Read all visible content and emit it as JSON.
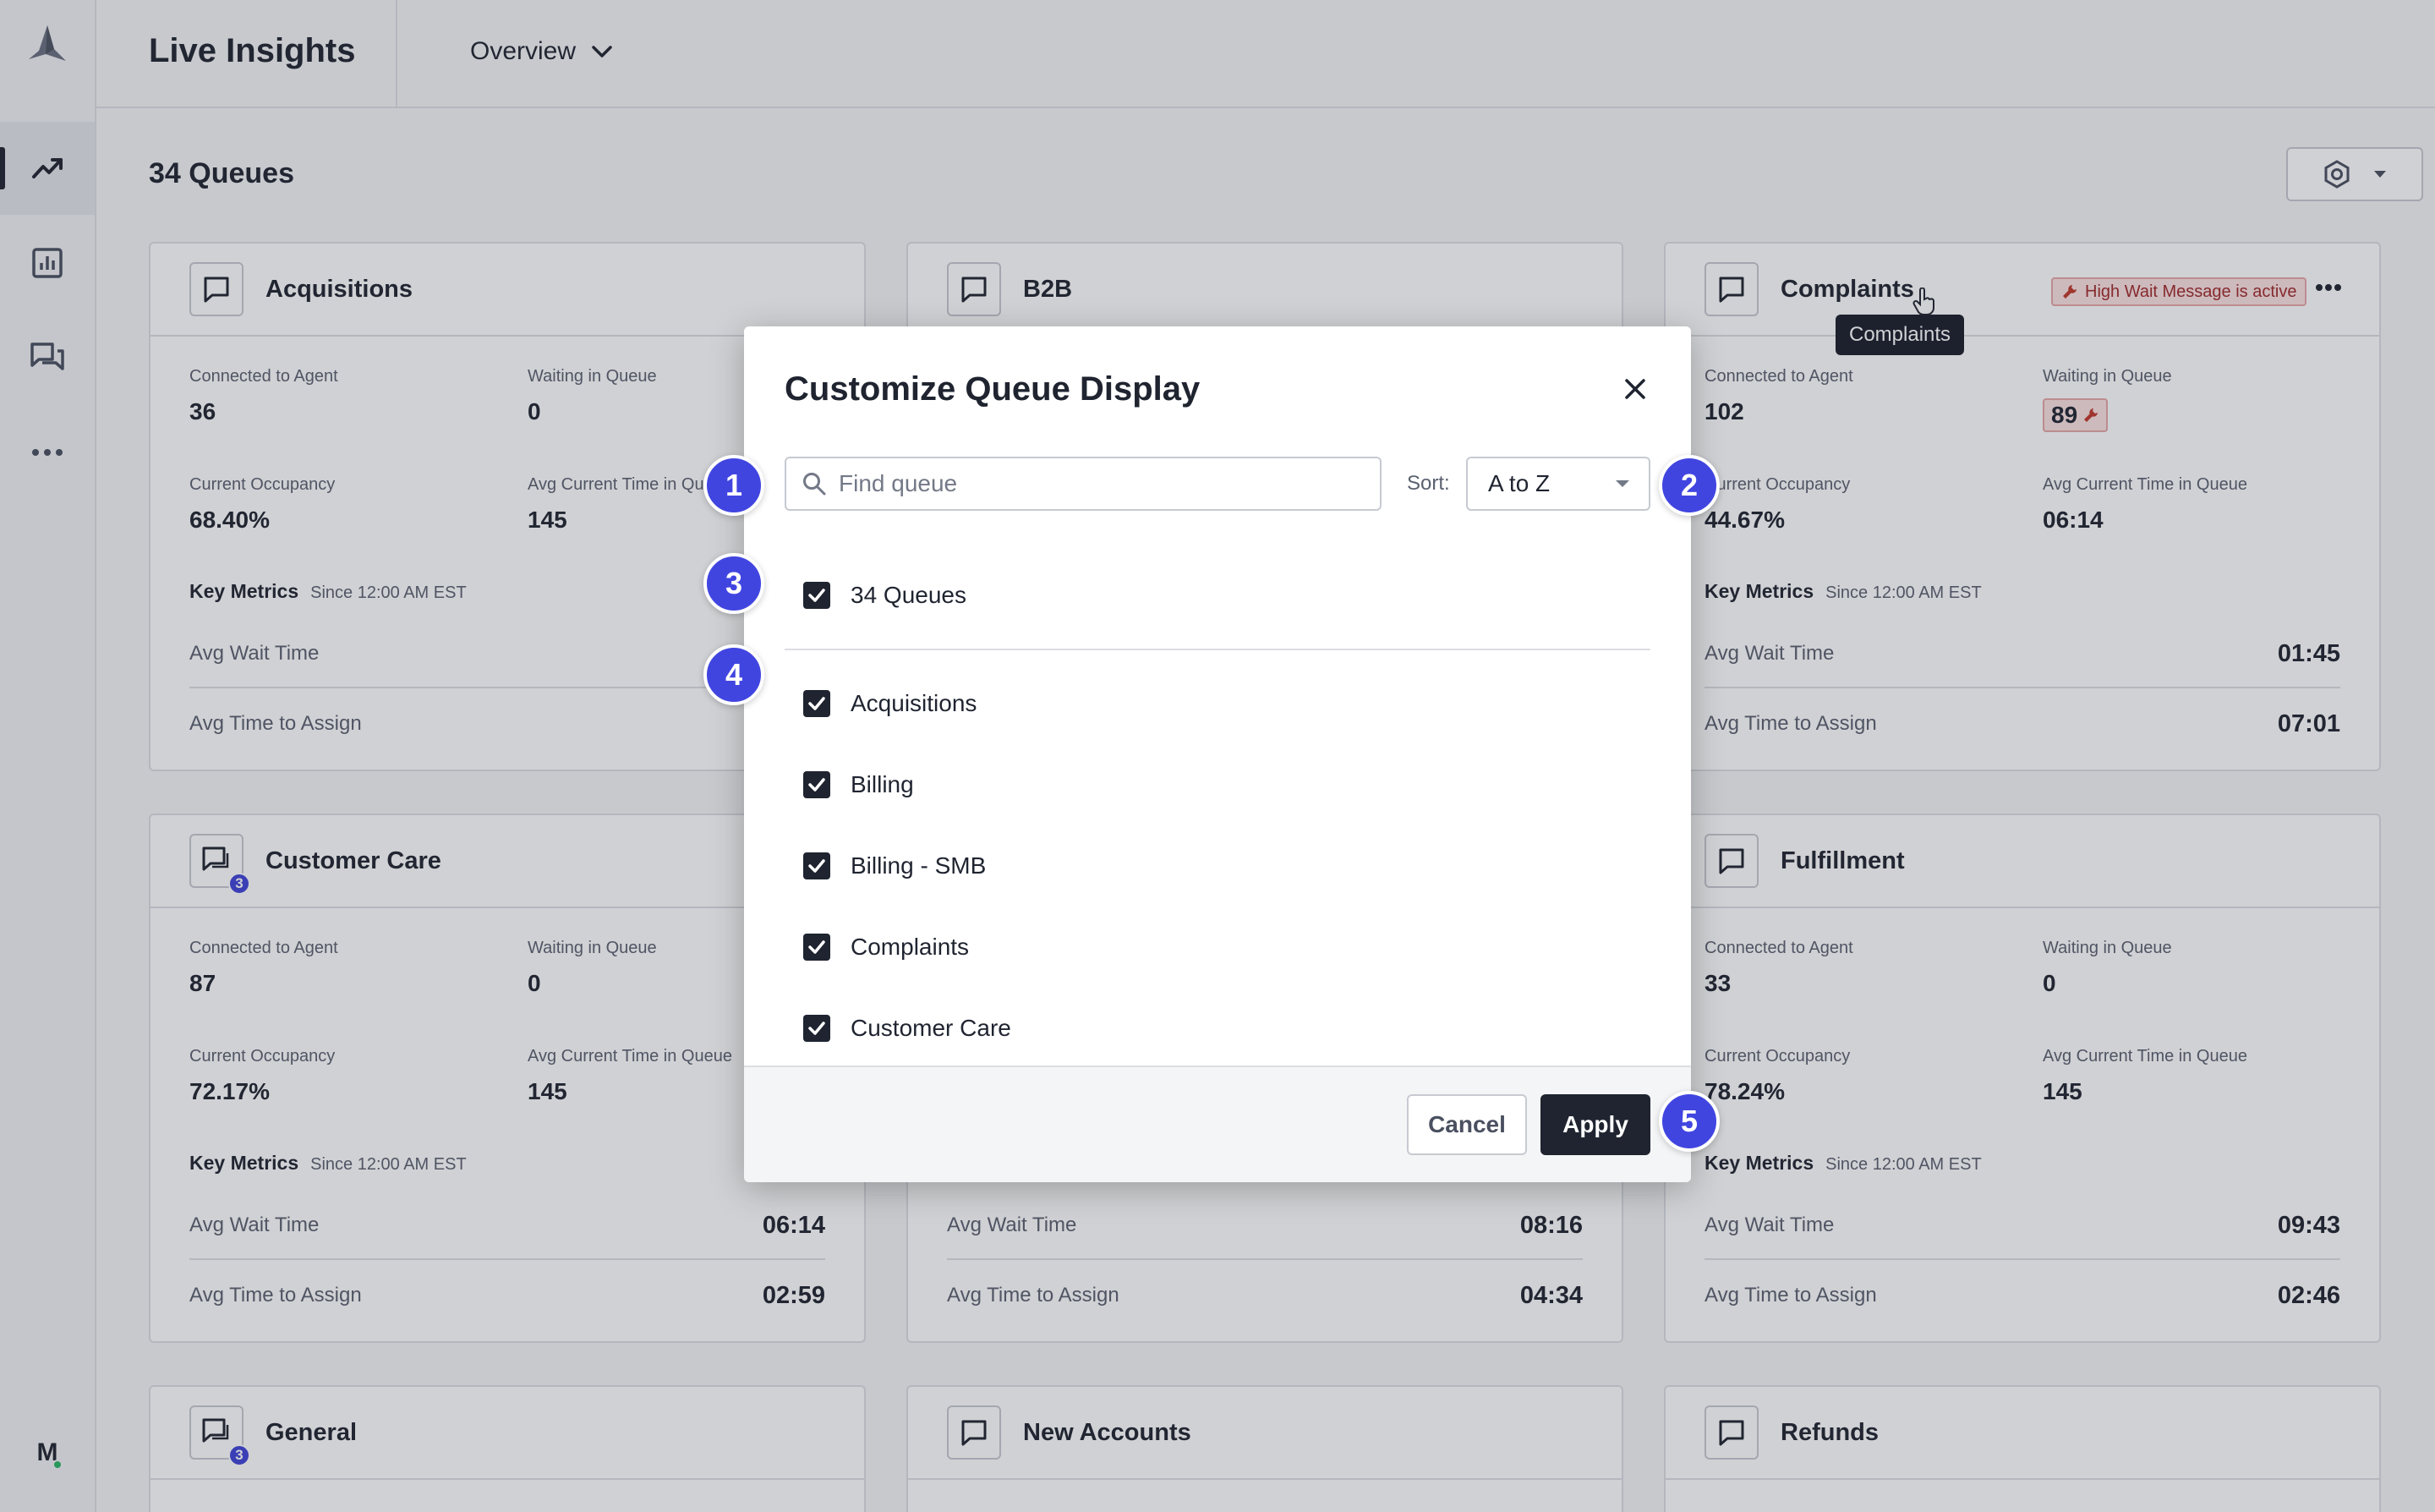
{
  "app": {
    "title": "Live Insights",
    "view": "Overview",
    "avatar_initial": "M"
  },
  "sidebar": {
    "items": [
      {
        "icon": "trending-up-icon"
      },
      {
        "icon": "bar-chart-icon"
      },
      {
        "icon": "chat-bubbles-icon"
      },
      {
        "icon": "more-horizontal-icon"
      }
    ]
  },
  "page": {
    "title": "34 Queues"
  },
  "labels": {
    "connected": "Connected to Agent",
    "waiting": "Waiting in Queue",
    "occupancy": "Current Occupancy",
    "avg_current": "Avg Current Time in Queue",
    "key_metrics": "Key Metrics",
    "since": "Since 12:00 AM EST",
    "avg_wait": "Avg Wait Time",
    "avg_assign": "Avg Time to Assign"
  },
  "cards": [
    {
      "name": "Acquisitions",
      "connected": "36",
      "waiting": "0",
      "occupancy": "68.40%",
      "avg_current": "145",
      "avg_wait": "",
      "avg_assign": ""
    },
    {
      "name": "B2B"
    },
    {
      "name": "Complaints",
      "connected": "102",
      "waiting": "89",
      "occupancy": "44.67%",
      "avg_current": "06:14",
      "avg_wait": "01:45",
      "avg_assign": "07:01",
      "badge": "High Wait Message is active",
      "tooltip": "Complaints"
    },
    {
      "name": "Customer Care",
      "badge_count": "3",
      "connected": "87",
      "waiting": "0",
      "occupancy": "72.17%",
      "avg_current": "145",
      "avg_wait": "06:14",
      "avg_assign": "02:59"
    },
    {
      "name": "",
      "avg_wait": "08:16",
      "avg_assign": "04:34"
    },
    {
      "name": "Fulfillment",
      "connected": "33",
      "waiting": "0",
      "occupancy": "78.24%",
      "avg_current": "145",
      "avg_wait": "09:43",
      "avg_assign": "02:46"
    },
    {
      "name": "General",
      "badge_count": "3"
    },
    {
      "name": "New Accounts"
    },
    {
      "name": "Refunds"
    }
  ],
  "modal": {
    "title": "Customize Queue Display",
    "search_placeholder": "Find queue",
    "sort_label": "Sort:",
    "sort_value": "A to Z",
    "select_all": "34 Queues",
    "queues": [
      "Acquisitions",
      "Billing",
      "Billing - SMB",
      "Complaints",
      "Customer Care"
    ],
    "cancel": "Cancel",
    "apply": "Apply"
  },
  "steps": [
    "1",
    "2",
    "3",
    "4",
    "5"
  ],
  "colors": {
    "accent": "#4145e0",
    "dark": "#1f2430",
    "danger": "#a12a2a",
    "online": "#2ab564"
  }
}
